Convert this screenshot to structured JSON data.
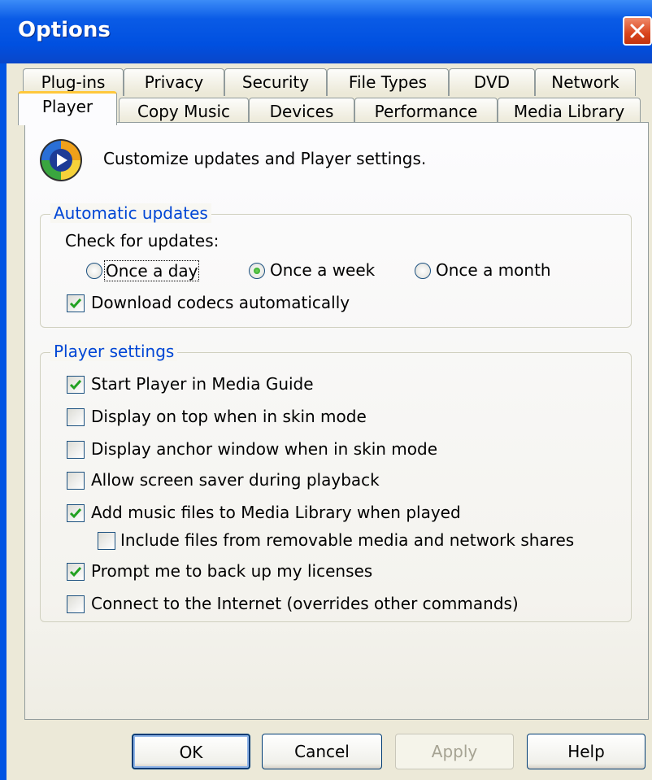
{
  "window": {
    "title": "Options",
    "close_icon": "close-icon"
  },
  "tabs": {
    "back_row": [
      "Plug-ins",
      "Privacy",
      "Security",
      "File Types",
      "DVD",
      "Network"
    ],
    "front_row": [
      "Player",
      "Copy Music",
      "Devices",
      "Performance",
      "Media Library"
    ],
    "active": "Player"
  },
  "intro": {
    "icon": "media-player-icon",
    "text": "Customize updates and Player settings."
  },
  "automatic_updates": {
    "legend": "Automatic updates",
    "check_label": "Check for updates:",
    "options": [
      {
        "label": "Once a day",
        "checked": false
      },
      {
        "label": "Once a week",
        "checked": true
      },
      {
        "label": "Once a month",
        "checked": false
      }
    ],
    "download_codecs": {
      "label": "Download codecs automatically",
      "checked": true
    }
  },
  "player_settings": {
    "legend": "Player settings",
    "items": [
      {
        "label": "Start Player in Media Guide",
        "checked": true
      },
      {
        "label": "Display on top when in skin mode",
        "checked": false
      },
      {
        "label": "Display anchor window when in skin mode",
        "checked": false
      },
      {
        "label": "Allow screen saver during playback",
        "checked": false
      },
      {
        "label": "Add music files to Media Library when played",
        "checked": true
      },
      {
        "label": "Include files from removable media and network shares",
        "checked": false
      },
      {
        "label": "Prompt me to back up my licenses",
        "checked": true
      },
      {
        "label": "Connect to the Internet (overrides other commands)",
        "checked": false
      }
    ]
  },
  "buttons": {
    "ok": "OK",
    "cancel": "Cancel",
    "apply": "Apply",
    "help": "Help"
  },
  "colors": {
    "title_bar": "#0054e3",
    "active_tab_accent": "#ffc83c",
    "legend_text": "#0046d5"
  }
}
